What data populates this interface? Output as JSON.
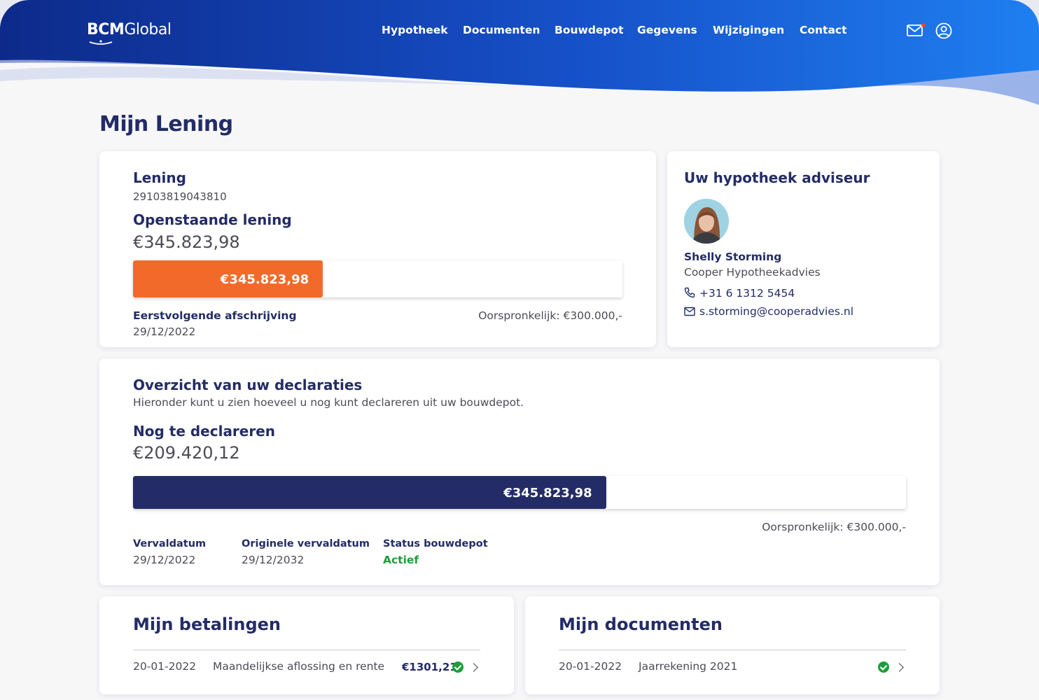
{
  "app": {
    "logo_bold": "BCM",
    "logo_light": "Global"
  },
  "nav": {
    "items": [
      "Hypotheek",
      "Documenten",
      "Bouwdepot",
      "Gegevens",
      "Wijzigingen",
      "Contact"
    ]
  },
  "header_icons": [
    "mail-icon",
    "user-icon"
  ],
  "page": {
    "title": "Mijn Lening"
  },
  "loan": {
    "title": "Lening",
    "number": "29103819043810",
    "outstanding_label": "Openstaande lening",
    "outstanding_value": "€345.823,98",
    "bar_label": "€345.823,98",
    "bar_fraction": 0.388,
    "bar_color": "#f26a2a",
    "next_debit_label": "Eerstvolgende afschrijving",
    "next_debit_date": "29/12/2022",
    "original": "Oorspronkelijk: €300.000,-"
  },
  "advisor": {
    "title": "Uw hypotheek adviseur",
    "name": "Shelly Storming",
    "company": "Cooper Hypotheekadvies",
    "phone": "+31 6 1312 5454",
    "email": "s.storming@cooperadvies.nl"
  },
  "declarations": {
    "title": "Overzicht van uw declaraties",
    "subtitle": "Hieronder kunt u zien hoeveel u nog kunt declareren uit uw bouwdepot.",
    "remaining_label": "Nog te declareren",
    "remaining_value": "€209.420,12",
    "bar_label": "€345.823,98",
    "bar_fraction": 0.612,
    "bar_color": "#232c66",
    "original": "Oorspronkelijk: €300.000,-",
    "due_label": "Vervaldatum",
    "due_value": "29/12/2022",
    "orig_due_label": "Originele vervaldatum",
    "orig_due_value": "29/12/2032",
    "status_label": "Status bouwdepot",
    "status_value": "Actief",
    "status_color": "#1e9e3a"
  },
  "payments": {
    "title": "Mijn betalingen",
    "rows": [
      {
        "date": "20-01-2022",
        "description": "Maandelijkse aflossing en rente",
        "amount": "€1301,21"
      }
    ]
  },
  "documents": {
    "title": "Mijn documenten",
    "rows": [
      {
        "date": "20-01-2022",
        "name": "Jaarrekening 2021"
      }
    ]
  }
}
